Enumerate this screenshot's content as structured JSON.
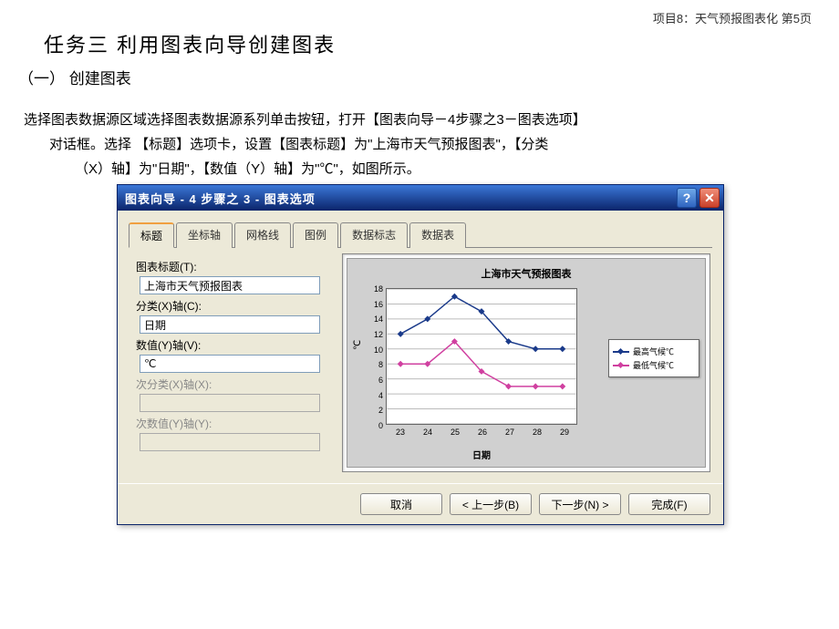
{
  "page": {
    "header": "项目8：天气预报图表化   第5页",
    "task_title": "任务三 利用图表向导创建图表",
    "section_title": "（一） 创建图表",
    "body_line1": "选择图表数据源区域选择图表数据源系列单击按钮，打开【图表向导－4步骤之3－图表选项】",
    "body_line2": "对话框。选择 【标题】选项卡，设置【图表标题】为\"上海市天气预报图表\"，【分类",
    "body_line3": "（X）轴】为\"日期\"，【数值（Y）轴】为\"℃\"，如图所示。"
  },
  "dialog": {
    "title": "图表向导 - 4 步骤之 3 - 图表选项",
    "tabs": [
      "标题",
      "坐标轴",
      "网格线",
      "图例",
      "数据标志",
      "数据表"
    ],
    "active_tab": 0,
    "form": {
      "chart_title_label": "图表标题(T):",
      "chart_title_value": "上海市天气预报图表",
      "x_axis_label": "分类(X)轴(C):",
      "x_axis_value": "日期",
      "y_axis_label": "数值(Y)轴(V):",
      "y_axis_value": "℃",
      "x2_axis_label": "次分类(X)轴(X):",
      "x2_axis_value": "",
      "y2_axis_label": "次数值(Y)轴(Y):",
      "y2_axis_value": ""
    },
    "preview": {
      "title": "上海市天气预报图表",
      "y_label": "℃",
      "x_label": "日期",
      "legend": {
        "high": "最高气候℃",
        "low": "最低气候℃"
      }
    },
    "buttons": {
      "cancel": "取消",
      "back": "< 上一步(B)",
      "next": "下一步(N) >",
      "finish": "完成(F)"
    }
  },
  "chart_data": {
    "type": "line",
    "title": "上海市天气预报图表",
    "xlabel": "日期",
    "ylabel": "℃",
    "categories": [
      "23",
      "24",
      "25",
      "26",
      "27",
      "28",
      "29"
    ],
    "series": [
      {
        "name": "最高气候℃",
        "values": [
          12,
          14,
          17,
          15,
          11,
          10,
          10
        ]
      },
      {
        "name": "最低气候℃",
        "values": [
          8,
          8,
          11,
          7,
          5,
          5,
          5
        ]
      }
    ],
    "ylim": [
      0,
      18
    ],
    "yticks": [
      0,
      2,
      4,
      6,
      8,
      10,
      12,
      14,
      16,
      18
    ]
  }
}
